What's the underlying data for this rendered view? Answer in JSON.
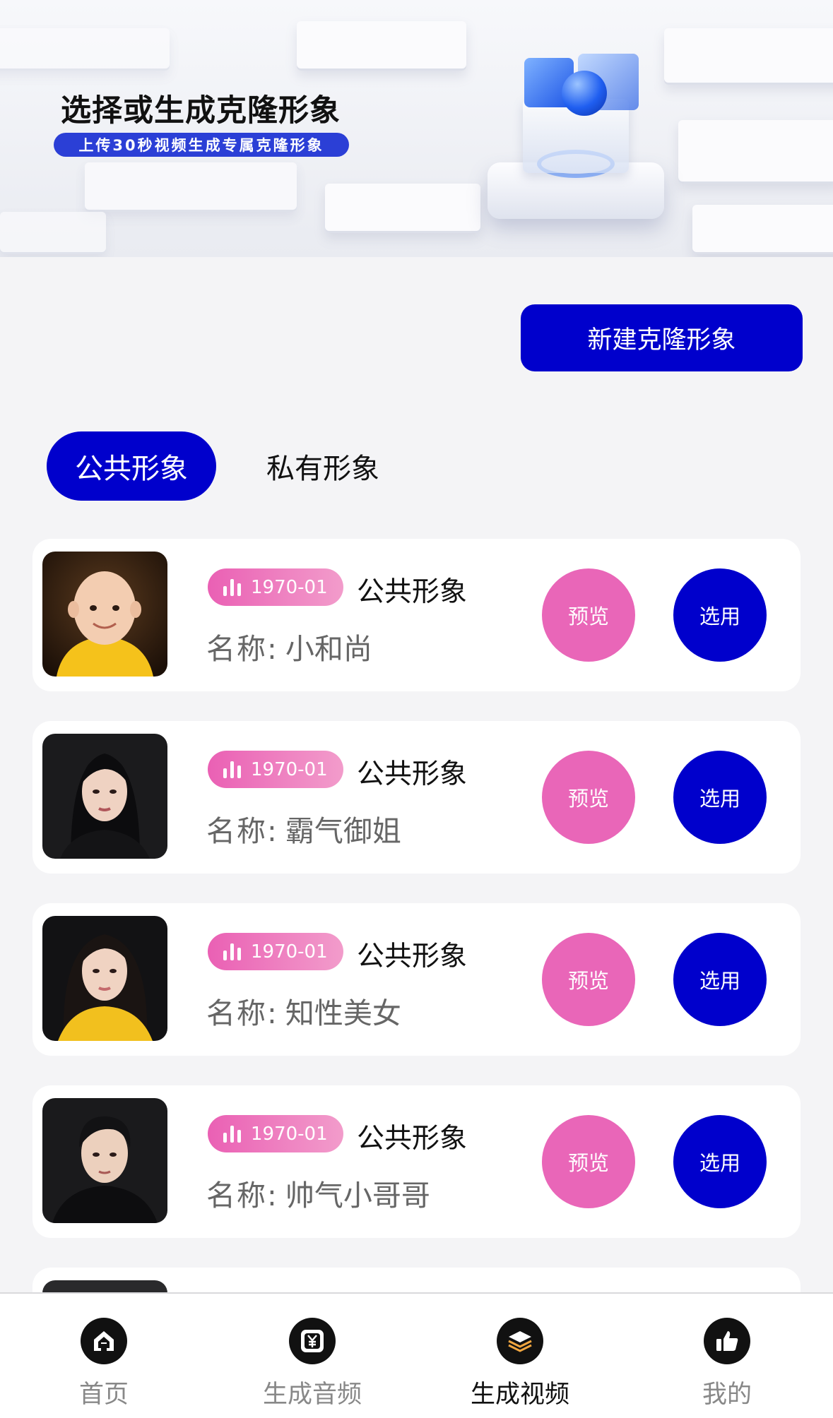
{
  "banner": {
    "title": "选择或生成克隆形象",
    "subtitle": "上传30秒视频生成专属克隆形象"
  },
  "actions": {
    "new_clone": "新建克隆形象"
  },
  "tabs": [
    {
      "label": "公共形象",
      "active": true
    },
    {
      "label": "私有形象",
      "active": false
    }
  ],
  "name_label": "名称:",
  "preview_label": "预览",
  "use_label": "选用",
  "avatars": [
    {
      "date": "1970-01",
      "type": "公共形象",
      "name": "小和尚"
    },
    {
      "date": "1970-01",
      "type": "公共形象",
      "name": "霸气御姐"
    },
    {
      "date": "1970-01",
      "type": "公共形象",
      "name": "知性美女"
    },
    {
      "date": "1970-01",
      "type": "公共形象",
      "name": "帅气小哥哥"
    }
  ],
  "nav": [
    {
      "label": "首页",
      "icon": "home-icon",
      "active": false
    },
    {
      "label": "生成音频",
      "icon": "yuan-square-icon",
      "active": false
    },
    {
      "label": "生成视频",
      "icon": "layers-icon",
      "active": true
    },
    {
      "label": "我的",
      "icon": "thumbs-up-icon",
      "active": false
    }
  ],
  "colors": {
    "primary": "#0000cc",
    "accent_pink": "#e966b8",
    "background": "#f4f4f6"
  }
}
